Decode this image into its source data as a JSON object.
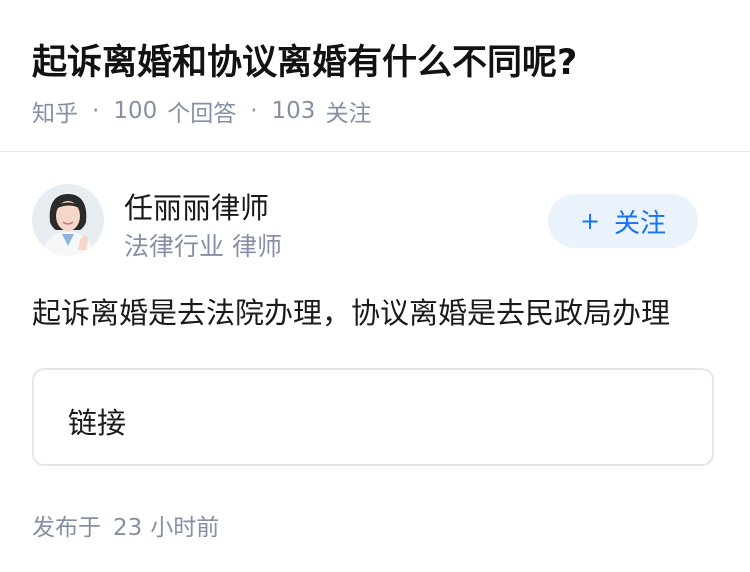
{
  "question": {
    "title": "起诉离婚和协议离婚有什么不同呢?",
    "source": "知乎",
    "answer_count": "100",
    "answer_label": "个回答",
    "follower_count": "103",
    "follower_label": "关注"
  },
  "author": {
    "name": "任丽丽律师",
    "title": "法律行业 律师",
    "follow_plus": "+",
    "follow_label": "关注"
  },
  "answer": {
    "text": "起诉离婚是去法院办理，协议离婚是去民政局办理",
    "link_label": "链接"
  },
  "publish": {
    "prefix": "发布于",
    "value": "23",
    "unit": "小时前"
  },
  "colors": {
    "accent": "#1772f6",
    "muted": "#8590a6",
    "follow_bg": "#eaf2fb"
  }
}
